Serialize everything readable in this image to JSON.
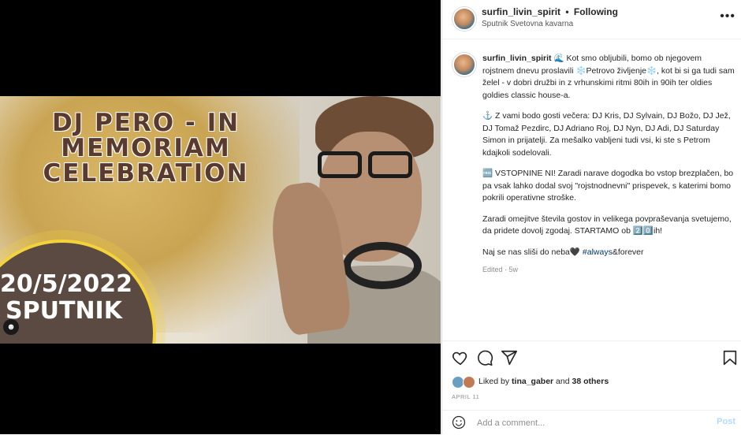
{
  "poster": {
    "title": "DJ PERO - IN MEMORIAM CELEBRATION",
    "date_line1": "20/5/2022",
    "date_line2": "SPUTNIK"
  },
  "header": {
    "username": "surfin_livin_spirit",
    "separator": "•",
    "follow_status": "Following",
    "location": "Sputnik Svetovna kavarna",
    "more_icon": "more-horizontal-icon"
  },
  "caption": {
    "username": "surfin_livin_spirit",
    "paragraphs": [
      "🌊 Kot smo obljubili, bomo ob njegovem rojstnem dnevu proslavili ❄️Petrovo življenje❄️, kot bi si ga tudi sam želel - v dobri družbi in z vrhunskimi ritmi 80ih in 90ih ter oldies goldies classic house-a.",
      "⚓ Z vami bodo gosti večera: DJ Kris, DJ Sylvain, DJ Božo, DJ Jež, DJ Tomaž Pezdirc, DJ Adriano Roj, DJ Nyn, DJ Adi, DJ Saturday Simon in prijatelji. Za mešalko vabljeni tudi vsi, ki ste s Petrom kdajkoli sodelovali.",
      "🆓 VSTOPNINE NI! Zaradi narave dogodka bo vstop brezplačen, bo pa vsak lahko dodal svoj \"rojstnodnevni\" prispevek, s katerimi bomo pokrili operativne stroške.",
      "Zaradi omejitve števila gostov in velikega povpraševanja svetujemo, da pridete dovolj zgodaj. STARTAMO ob 2️⃣0️⃣ih!"
    ],
    "last_line_prefix": "Naj se nas sliši do neba🖤 ",
    "hashtag": "#always",
    "last_line_suffix": "&forever",
    "edited": "Edited · 5w"
  },
  "actions": {
    "like_icon": "heart-icon",
    "comment_icon": "comment-icon",
    "share_icon": "share-icon",
    "save_icon": "bookmark-icon"
  },
  "likes": {
    "prefix": "Liked by ",
    "user": "tina_gaber",
    "middle": " and ",
    "others": "38 others"
  },
  "date": "APRIL 11",
  "comment": {
    "placeholder": "Add a comment...",
    "post_label": "Post",
    "emoji_icon": "smiley-icon"
  },
  "colors": {
    "text": "#262626",
    "muted": "#8e8e8e",
    "link": "#00376b",
    "post_disabled": "#b3dbff"
  }
}
